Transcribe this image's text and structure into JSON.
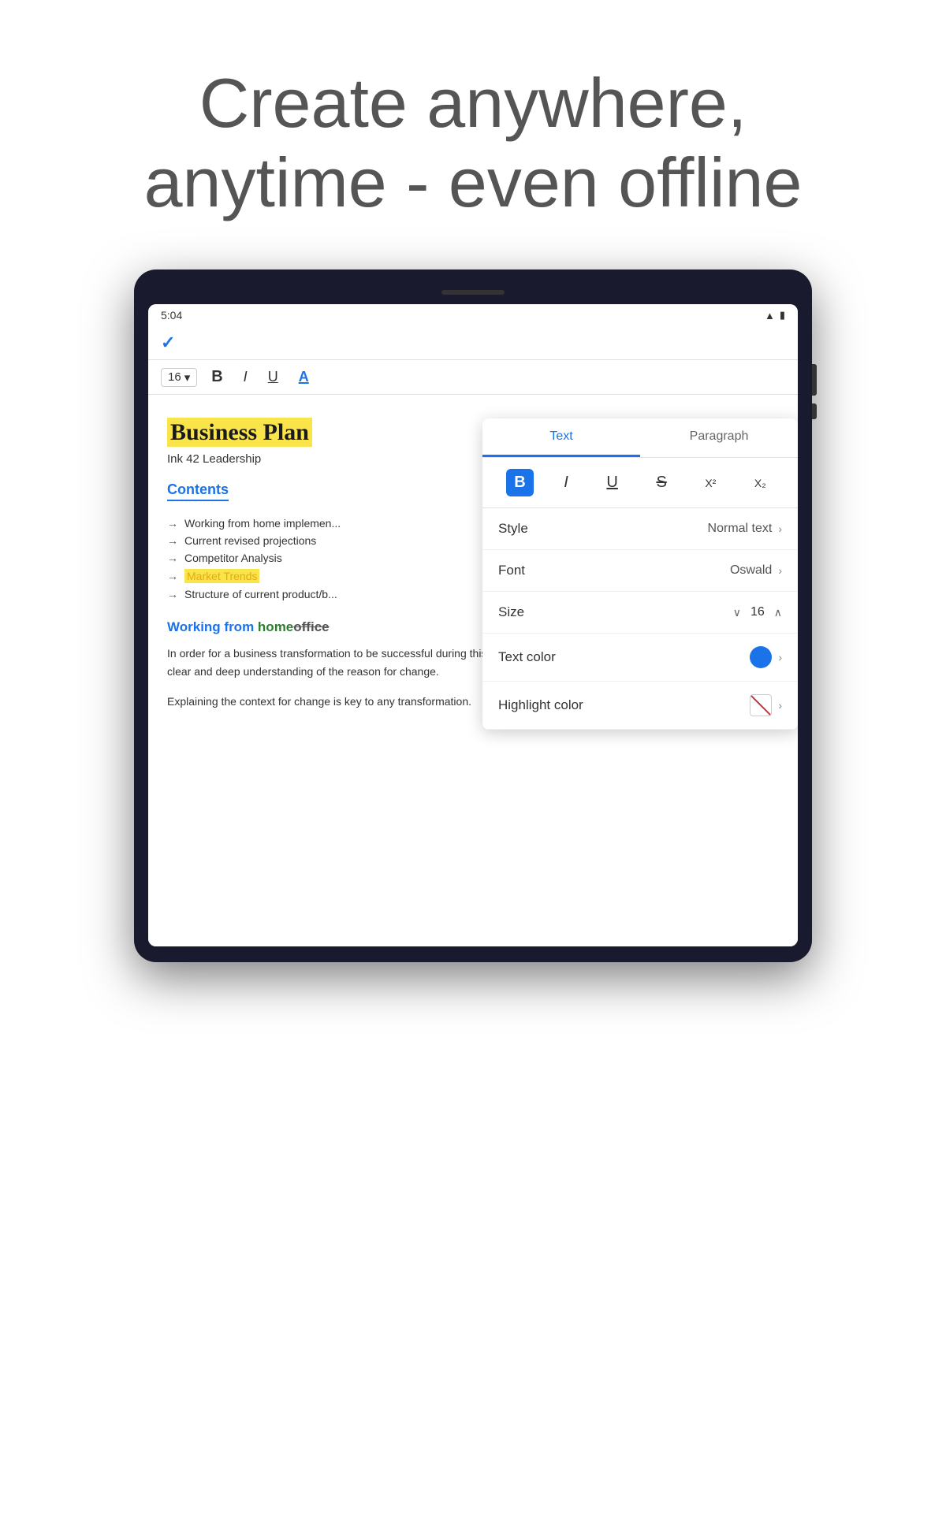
{
  "hero": {
    "line1": "Create anywhere,",
    "line2": "anytime - even offline"
  },
  "status_bar": {
    "time": "5:04",
    "signal": "▲",
    "battery": "🔋"
  },
  "toolbar": {
    "checkmark": "✓"
  },
  "format_bar": {
    "font_size": "16",
    "dropdown_arrow": "▾",
    "bold": "B",
    "italic": "I",
    "underline": "U",
    "color": "A"
  },
  "document": {
    "title": "Business Plan",
    "subtitle": "Ink 42 Leadership",
    "contents_heading": "Contents",
    "contents_items": [
      {
        "text": "Working from home implemen..."
      },
      {
        "text": "Current revised projections"
      },
      {
        "text": "Competitor Analysis"
      },
      {
        "text": "Market Trends",
        "highlighted": true
      },
      {
        "text": "Structure of current product/b..."
      }
    ],
    "section_heading_prefix": "Working from ",
    "section_heading_green": "home",
    "section_heading_strikethrough": "office",
    "body1": "In order for a business transformation to be successful during this uncertain time leaders need to manage change through a clear and deep understanding of the reason for change.",
    "body2": "Explaining the context for change is key to any transformation."
  },
  "panel": {
    "tab_text": "Text",
    "tab_paragraph": "Paragraph",
    "format_buttons": {
      "bold": "B",
      "italic": "I",
      "underline": "U",
      "strikethrough": "S",
      "superscript": "X²",
      "subscript": "X₂"
    },
    "style_label": "Style",
    "style_value": "Normal text",
    "font_label": "Font",
    "font_value": "Oswald",
    "size_label": "Size",
    "size_value": "16",
    "text_color_label": "Text color",
    "text_color_hex": "#1a73e8",
    "highlight_color_label": "Highlight color"
  }
}
